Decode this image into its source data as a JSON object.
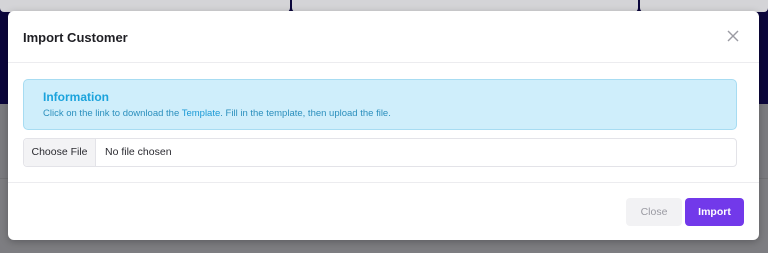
{
  "modal": {
    "title": "Import Customer",
    "close_icon": "close-icon"
  },
  "info": {
    "heading": "Information",
    "text_before": "Click on the link to download the ",
    "link_label": "Template",
    "text_after": ". Fill in the template, then upload the file."
  },
  "file_input": {
    "button_label": "Choose File",
    "status": "No file chosen"
  },
  "footer": {
    "close_label": "Close",
    "import_label": "Import"
  },
  "colors": {
    "accent": "#7239ea",
    "info_bg": "#cfeefb",
    "info_heading": "#1ba3dc",
    "backdrop_dark": "#0d0742"
  }
}
